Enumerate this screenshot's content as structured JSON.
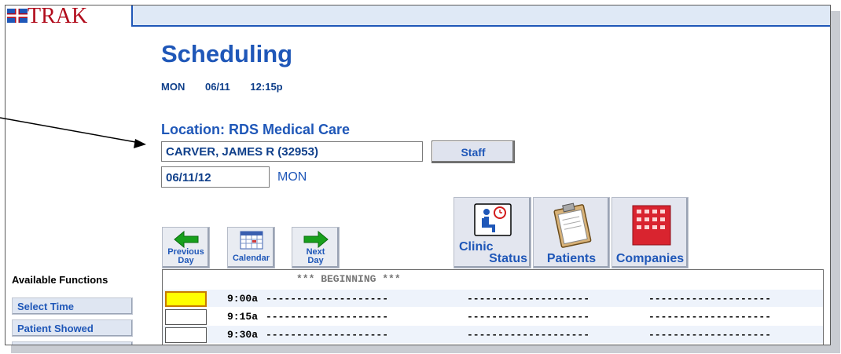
{
  "app": {
    "logo_text": "TRAK"
  },
  "header": {
    "title": "Scheduling",
    "day": "MON",
    "date": "06/11",
    "time": "12:15p"
  },
  "location_label": "Location: RDS Medical Care",
  "patient_value": "CARVER, JAMES R (32953)",
  "staff_button": "Staff",
  "date_value": "06/11/12",
  "day_of_week": "MON",
  "nav": {
    "prev_day_line1": "Previous",
    "prev_day_line2": "Day",
    "calendar": "Calendar",
    "next_day_line1": "Next",
    "next_day_line2": "Day"
  },
  "big_buttons": {
    "clinic_status_line1": "Clinic",
    "clinic_status_line2": "Status",
    "patients": "Patients",
    "companies": "Companies"
  },
  "functions": {
    "heading": "Available Functions",
    "items": [
      "Select Time",
      "Patient Showed"
    ]
  },
  "schedule": {
    "beginning": "*** BEGINNING ***",
    "dashes": "--------------------",
    "rows": [
      {
        "time": "9:00a"
      },
      {
        "time": "9:15a"
      },
      {
        "time": "9:30a"
      }
    ]
  },
  "colors": {
    "accent": "#1f57b8",
    "selected_slot": "#ffff00",
    "brand_red": "#b10c1c"
  }
}
